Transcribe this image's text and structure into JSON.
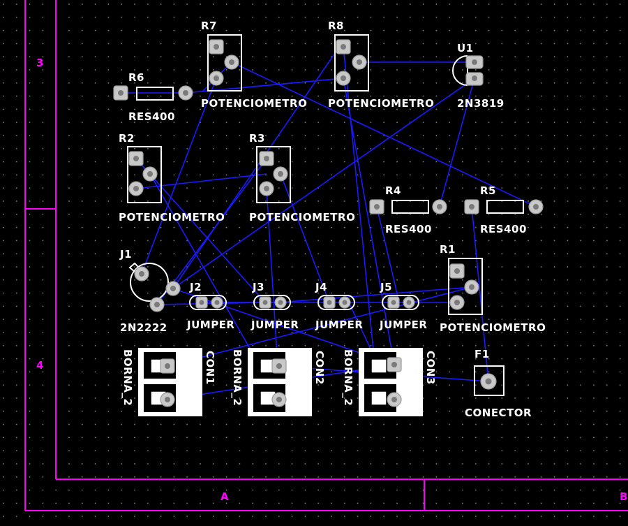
{
  "frame": {
    "zone_left_top": "3",
    "zone_left_bottom": "4",
    "zone_bottom_a": "A",
    "zone_bottom_b": "B"
  },
  "colors": {
    "background": "#000000",
    "frame": "#ff00ff",
    "silkscreen": "#ffffff",
    "trace": "#1a1aff",
    "pad": "#c8c8c8"
  },
  "components": {
    "r7": {
      "ref": "R7",
      "value": "POTENCIOMETRO"
    },
    "r8": {
      "ref": "R8",
      "value": "POTENCIOMETRO"
    },
    "u1": {
      "ref": "U1",
      "value": "2N3819"
    },
    "r6": {
      "ref": "R6",
      "value": "RES400"
    },
    "r2": {
      "ref": "R2",
      "value": "POTENCIOMETRO"
    },
    "r3": {
      "ref": "R3",
      "value": "POTENCIOMETRO"
    },
    "r4": {
      "ref": "R4",
      "value": "RES400"
    },
    "r5": {
      "ref": "R5",
      "value": "RES400"
    },
    "r1": {
      "ref": "R1",
      "value": "POTENCIOMETRO"
    },
    "j1": {
      "ref": "J1",
      "value": "2N2222"
    },
    "j2": {
      "ref": "J2",
      "value": "JUMPER"
    },
    "j3": {
      "ref": "J3",
      "value": "JUMPER"
    },
    "j4": {
      "ref": "J4",
      "value": "JUMPER"
    },
    "j5": {
      "ref": "J5",
      "value": "JUMPER"
    },
    "con1": {
      "ref": "CON1",
      "value": "BORNA_2"
    },
    "con2": {
      "ref": "CON2",
      "value": "BORNA_2"
    },
    "con3": {
      "ref": "CON3",
      "value": "BORNA_2"
    },
    "f1": {
      "ref": "F1",
      "value": "CONECTOR"
    }
  }
}
